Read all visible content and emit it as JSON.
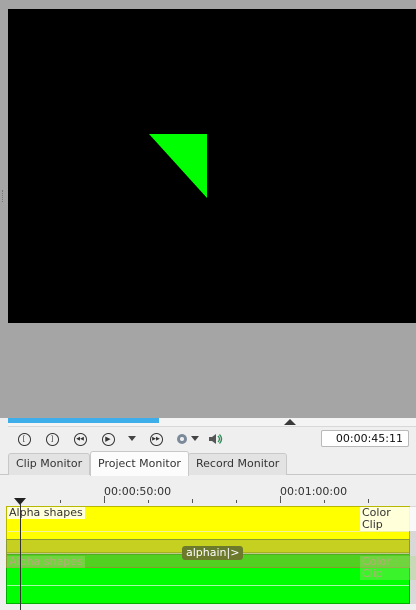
{
  "monitor": {
    "background_color": "#a5a5a5",
    "frame_color": "#000000",
    "shape_color": "#00ff00",
    "progress_fraction": 0.37,
    "timecode": "00:00:45:11"
  },
  "transport": {
    "buttons": [
      {
        "icon": "set-zone-start-icon",
        "glyph": "["
      },
      {
        "icon": "set-zone-end-icon",
        "glyph": "]"
      },
      {
        "icon": "rewind-icon",
        "glyph": "◀◀"
      },
      {
        "icon": "play-icon",
        "glyph": "▶"
      },
      {
        "icon": "forward-icon",
        "glyph": "▶▶"
      }
    ]
  },
  "tabs": [
    {
      "label": "Clip Monitor",
      "active": false
    },
    {
      "label": "Project Monitor",
      "active": true
    },
    {
      "label": "Record Monitor",
      "active": false
    }
  ],
  "timeline": {
    "ruler_labels": [
      "00:00:50:00",
      "00:01:00:00"
    ],
    "tracks": {
      "top_clip_left": "Alpha shapes",
      "top_clip_right": "Color Clip",
      "bottom_clip_left": "Alpha shapes",
      "bottom_clip_right": "Color Clip",
      "composition": "alphain|>"
    },
    "colors": {
      "track_top": "#ffff00",
      "track_bottom": "#00ff00",
      "composition": "#6d7a2c"
    }
  }
}
